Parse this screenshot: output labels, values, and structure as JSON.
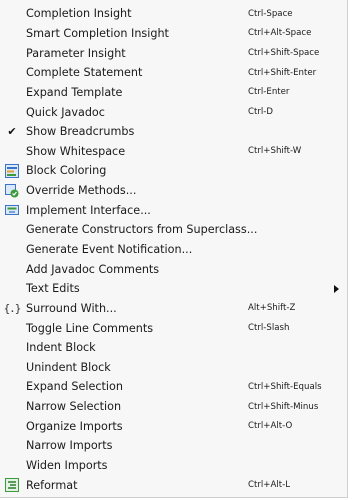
{
  "menu": {
    "items": [
      {
        "label": "Completion Insight",
        "shortcut": "Ctrl-Space"
      },
      {
        "label": "Smart Completion Insight",
        "shortcut": "Ctrl+Alt-Space"
      },
      {
        "label": "Parameter Insight",
        "shortcut": "Ctrl+Shift-Space"
      },
      {
        "label": "Complete Statement",
        "shortcut": "Ctrl+Shift-Enter"
      },
      {
        "label": "Expand Template",
        "shortcut": "Ctrl-Enter"
      },
      {
        "label": "Quick Javadoc",
        "shortcut": "Ctrl-D"
      },
      {
        "label": "Show Breadcrumbs",
        "shortcut": "",
        "checked": true
      },
      {
        "label": "Show Whitespace",
        "shortcut": "Ctrl+Shift-W"
      },
      {
        "label": "Block Coloring",
        "shortcut": "",
        "icon": "block-coloring-icon"
      },
      {
        "label": "Override Methods...",
        "shortcut": "",
        "icon": "override-methods-icon"
      },
      {
        "label": "Implement Interface...",
        "shortcut": "",
        "icon": "implement-interface-icon"
      },
      {
        "label": "Generate Constructors from Superclass...",
        "shortcut": ""
      },
      {
        "label": "Generate Event Notification...",
        "shortcut": ""
      },
      {
        "label": "Add Javadoc Comments",
        "shortcut": ""
      },
      {
        "label": "Text Edits",
        "shortcut": "",
        "submenu": true
      },
      {
        "label": "Surround With...",
        "shortcut": "Alt+Shift-Z",
        "icon": "braces-icon"
      },
      {
        "label": "Toggle Line Comments",
        "shortcut": "Ctrl-Slash"
      },
      {
        "label": "Indent Block",
        "shortcut": ""
      },
      {
        "label": "Unindent Block",
        "shortcut": ""
      },
      {
        "label": "Expand Selection",
        "shortcut": "Ctrl+Shift-Equals"
      },
      {
        "label": "Narrow Selection",
        "shortcut": "Ctrl+Shift-Minus"
      },
      {
        "label": "Organize Imports",
        "shortcut": "Ctrl+Alt-O"
      },
      {
        "label": "Narrow Imports",
        "shortcut": ""
      },
      {
        "label": "Widen Imports",
        "shortcut": ""
      },
      {
        "label": "Reformat",
        "shortcut": "Ctrl+Alt-L",
        "icon": "reformat-icon"
      }
    ]
  },
  "colors": {
    "menu_background": "#f7f7f7",
    "text": "#1a1a1a",
    "icon_blue": "#3a73c8",
    "icon_green": "#3c9a3c"
  }
}
